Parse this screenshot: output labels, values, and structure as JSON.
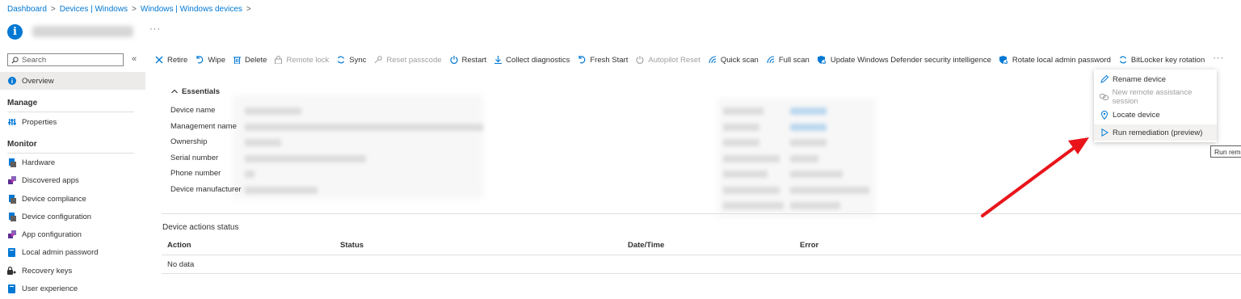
{
  "breadcrumb": {
    "items": [
      "Dashboard",
      "Devices | Windows",
      "Windows | Windows devices"
    ],
    "separator": ">"
  },
  "title": {
    "more": "···"
  },
  "sidebar": {
    "search_placeholder": "Search",
    "collapse": "«",
    "overview": "Overview",
    "manage_header": "Manage",
    "properties": "Properties",
    "monitor_header": "Monitor",
    "monitor_items": [
      {
        "label": "Hardware",
        "icon": "hardware-icon"
      },
      {
        "label": "Discovered apps",
        "icon": "apps-icon"
      },
      {
        "label": "Device compliance",
        "icon": "compliance-icon"
      },
      {
        "label": "Device configuration",
        "icon": "configuration-icon"
      },
      {
        "label": "App configuration",
        "icon": "app-config-icon"
      },
      {
        "label": "Local admin password",
        "icon": "password-icon"
      },
      {
        "label": "Recovery keys",
        "icon": "key-icon"
      },
      {
        "label": "User experience",
        "icon": "experience-icon"
      }
    ]
  },
  "toolbar": {
    "retire": "Retire",
    "wipe": "Wipe",
    "delete": "Delete",
    "remote_lock": "Remote lock",
    "sync": "Sync",
    "reset_passcode": "Reset passcode",
    "restart": "Restart",
    "collect_diagnostics": "Collect diagnostics",
    "fresh_start": "Fresh Start",
    "autopilot_reset": "Autopilot Reset",
    "quick_scan": "Quick scan",
    "full_scan": "Full scan",
    "update_defender": "Update Windows Defender security intelligence",
    "rotate_admin": "Rotate local admin password",
    "bitlocker": "BitLocker key rotation",
    "more": "···"
  },
  "dropdown": {
    "rename": "Rename device",
    "remote_assist": "New remote assistance session",
    "locate": "Locate device",
    "remediation": "Run remediation (preview)"
  },
  "tooltip": "Run reme",
  "essentials": {
    "header": "Essentials",
    "labels": [
      "Device name",
      "Management name",
      "Ownership",
      "Serial number",
      "Phone number",
      "Device manufacturer"
    ]
  },
  "actions_status": {
    "title": "Device actions status",
    "columns": [
      "Action",
      "Status",
      "Date/Time",
      "Error"
    ],
    "empty": "No data"
  },
  "colors": {
    "accent": "#0078d4",
    "arrow": "#e8141a",
    "disabled": "#a19f9d"
  }
}
